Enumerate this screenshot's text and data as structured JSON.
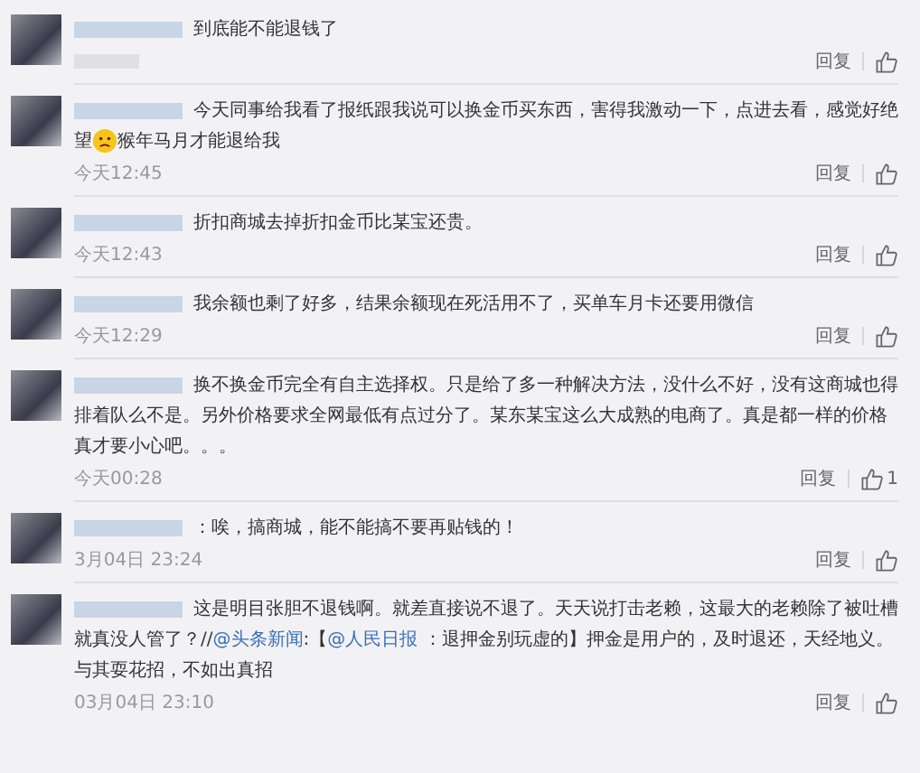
{
  "comments": [
    {
      "segments": [
        {
          "kind": "text",
          "text": "到底能不能退钱了"
        }
      ],
      "reply": "回复"
    },
    {
      "segments": [
        {
          "kind": "text",
          "text": "今天同事给我看了报纸跟我说可以换金币买东西，害得我激动一下，点进去看，感觉好绝望"
        },
        {
          "kind": "emoji"
        },
        {
          "kind": "text",
          "text": "猴年马月才能退给我"
        }
      ],
      "time": "今天12:45",
      "reply": "回复"
    },
    {
      "segments": [
        {
          "kind": "text",
          "text": "折扣商城去掉折扣金币比某宝还贵。"
        }
      ],
      "time": "今天12:43",
      "reply": "回复"
    },
    {
      "segments": [
        {
          "kind": "text",
          "text": "我余额也剩了好多，结果余额现在死活用不了，买单车月卡还要用微信"
        }
      ],
      "time": "今天12:29",
      "reply": "回复"
    },
    {
      "segments": [
        {
          "kind": "text",
          "text": "换不换金币完全有自主选择权。只是给了多一种解决方法，没什么不好，没有这商城也得排着队么不是。另外价格要求全网最低有点过分了。某东某宝这么大成熟的电商了。真是都一样的价格真才要小心吧。。。"
        }
      ],
      "time": "今天00:28",
      "reply": "回复",
      "likes": "1"
    },
    {
      "segments": [
        {
          "kind": "text",
          "text": "：唉，搞商城，能不能搞不要再贴钱的！"
        }
      ],
      "time": "3月04日 23:24",
      "reply": "回复"
    },
    {
      "segments": [
        {
          "kind": "text",
          "text": "这是明目张胆不退钱啊。就差直接说不退了。天天说打击老赖，这最大的老赖除了被吐槽就真没人管了？//"
        },
        {
          "kind": "link",
          "text": "@头条新闻"
        },
        {
          "kind": "text",
          "text": ":【"
        },
        {
          "kind": "link",
          "text": "@人民日报"
        },
        {
          "kind": "text",
          "text": " ：退押金别玩虚的】押金是用户的，及时退还，天经地义。与其耍花招，不如出真招"
        }
      ],
      "time": "03月04日 23:10",
      "reply": "回复"
    }
  ]
}
